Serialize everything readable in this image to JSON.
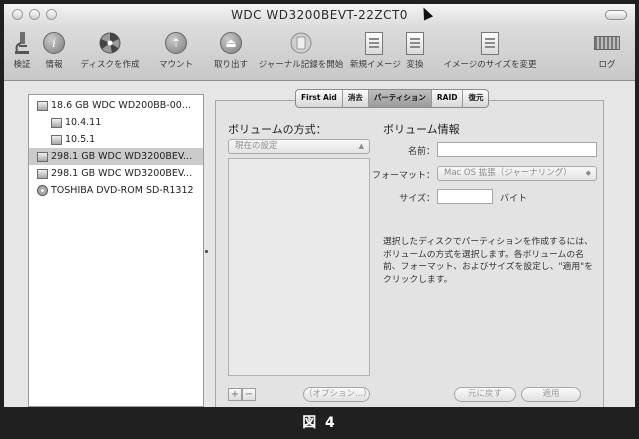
{
  "window": {
    "title": "WDC WD3200BEVT-22ZCT0"
  },
  "toolbar": {
    "items": [
      {
        "label": "検証",
        "icon": "microscope-icon"
      },
      {
        "label": "情報",
        "icon": "info-icon"
      },
      {
        "label": "ディスクを作成",
        "icon": "burn-icon"
      },
      {
        "label": "マウント",
        "icon": "mount-icon"
      },
      {
        "label": "取り出す",
        "icon": "eject-icon"
      },
      {
        "label": "ジャーナル記録を開始",
        "icon": "journal-icon"
      },
      {
        "label": "新規イメージ",
        "icon": "new-image-icon"
      },
      {
        "label": "変換",
        "icon": "convert-icon"
      },
      {
        "label": "イメージのサイズを変更",
        "icon": "resize-image-icon"
      },
      {
        "label": "ログ",
        "icon": "log-icon"
      }
    ]
  },
  "sidebar": {
    "items": [
      {
        "label": "18.6 GB WDC WD200BB-00...",
        "icon": "disk-icon",
        "indent": 0,
        "selected": false
      },
      {
        "label": "10.4.11",
        "icon": "volume-icon",
        "indent": 1,
        "selected": false
      },
      {
        "label": "10.5.1",
        "icon": "volume-icon",
        "indent": 1,
        "selected": false
      },
      {
        "label": "298.1 GB WDC WD3200BEV...",
        "icon": "disk-icon",
        "indent": 0,
        "selected": true
      },
      {
        "label": "298.1 GB WDC WD3200BEV...",
        "icon": "disk-icon",
        "indent": 0,
        "selected": false
      },
      {
        "label": "TOSHIBA DVD-ROM SD-R1312",
        "icon": "optical-drive-icon",
        "indent": 0,
        "selected": false
      }
    ]
  },
  "tabs": [
    {
      "label": "First Aid",
      "active": false
    },
    {
      "label": "消去",
      "active": false
    },
    {
      "label": "パーティション",
      "active": true
    },
    {
      "label": "RAID",
      "active": false
    },
    {
      "label": "復元",
      "active": false
    }
  ],
  "partition": {
    "layout_heading": "ボリュームの方式：",
    "layout_popup": "現在の設定",
    "info_heading": "ボリューム情報",
    "name_label": "名前：",
    "name_value": "",
    "format_label": "フォーマット：",
    "format_value": "Mac OS 拡張（ジャーナリング）",
    "size_label": "サイズ：",
    "size_value": "",
    "size_unit": "バイト",
    "description": "選択したディスクでパーティションを作成するには、ボリュームの方式を選択します。各ボリュームの名前、フォーマット、およびサイズを設定し、\"適用\"をクリックします。",
    "add_label": "+",
    "remove_label": "−",
    "options_label": "（オプション...）",
    "revert_label": "元に戻す",
    "apply_label": "適用"
  },
  "caption": "図 4"
}
